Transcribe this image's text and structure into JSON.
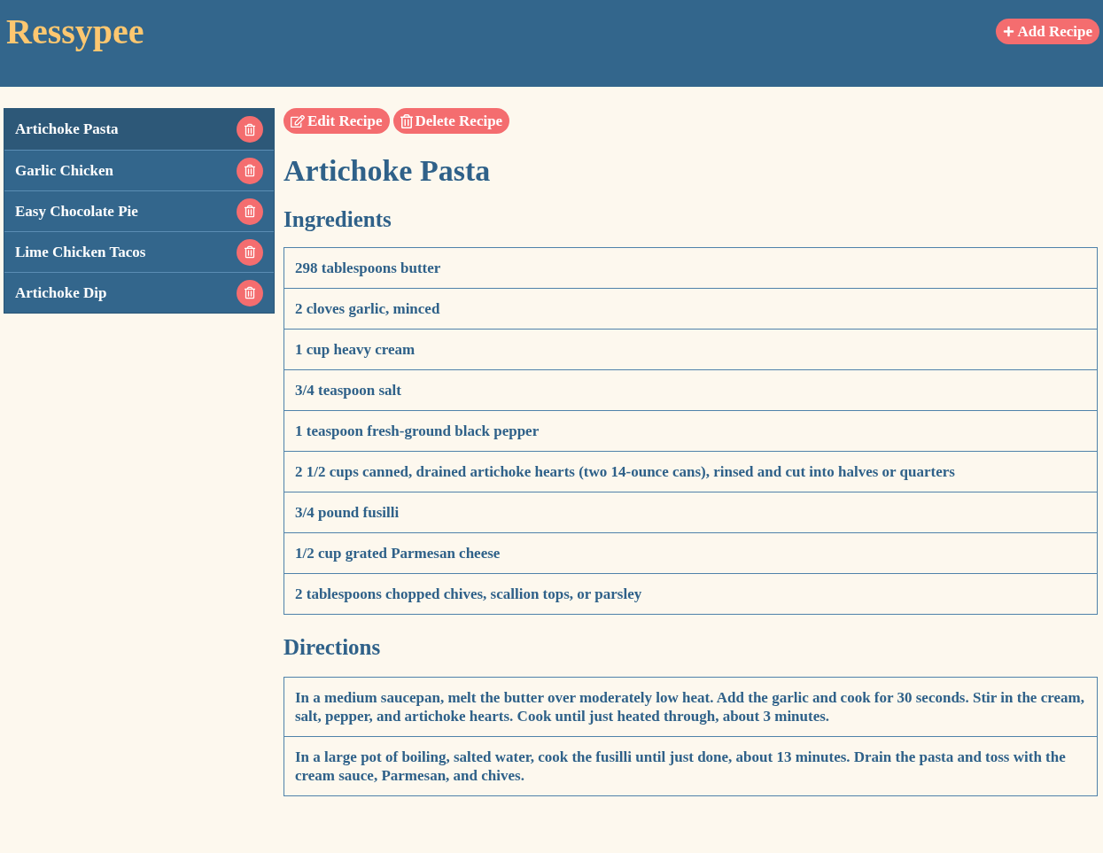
{
  "header": {
    "logo": "Ressypee",
    "add_button": {
      "label": "Add Recipe"
    }
  },
  "sidebar": {
    "items": [
      {
        "name": "Artichoke Pasta",
        "selected": true
      },
      {
        "name": "Garlic Chicken",
        "selected": false
      },
      {
        "name": "Easy Chocolate Pie",
        "selected": false
      },
      {
        "name": "Lime Chicken Tacos",
        "selected": false
      },
      {
        "name": "Artichoke Dip",
        "selected": false
      }
    ]
  },
  "recipe": {
    "actions": [
      {
        "label": "Edit Recipe",
        "kind": "edit"
      },
      {
        "label": "Delete Recipe",
        "kind": "delete"
      }
    ],
    "title": "Artichoke Pasta",
    "ingredients_heading": "Ingredients",
    "ingredients": [
      "298 tablespoons butter",
      "2 cloves garlic, minced",
      "1 cup heavy cream",
      "3/4 teaspoon salt",
      "1 teaspoon fresh-ground black pepper",
      "2 1/2 cups canned, drained artichoke hearts (two 14-ounce cans), rinsed and cut into halves or quarters",
      "3/4 pound fusilli",
      "1/2 cup grated Parmesan cheese",
      "2 tablespoons chopped chives, scallion tops, or parsley"
    ],
    "directions_heading": "Directions",
    "directions": [
      "In a medium saucepan, melt the butter over moderately low heat. Add the garlic and cook for 30 seconds. Stir in the cream, salt, pepper, and artichoke hearts. Cook until just heated through, about 3 minutes.",
      "In a large pot of boiling, salted water, cook the fusilli until just done, about 13 minutes. Drain the pasta and toss with the cream sauce, Parmesan, and chives."
    ]
  }
}
